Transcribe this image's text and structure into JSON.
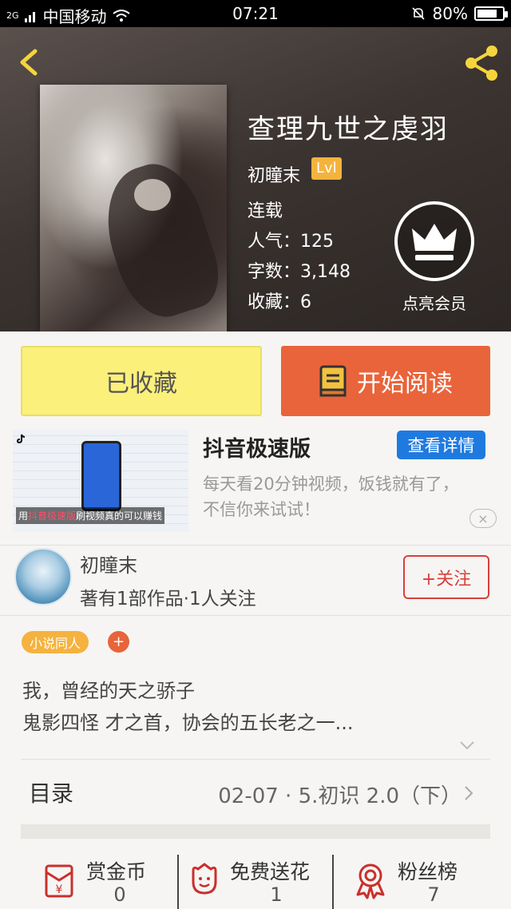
{
  "status_bar": {
    "network": "2G",
    "carrier": "中国移动",
    "time": "07:21",
    "battery": "80%",
    "battery_level": 0.8
  },
  "book": {
    "title": "查理九世之虔羽",
    "author": "初瞳末",
    "level": "Lvl",
    "status": "连载",
    "popularity": "人气：125",
    "word_count": "字数：3,148",
    "favorites": "收藏：6"
  },
  "vip": {
    "label": "点亮会员"
  },
  "actions": {
    "collect_label": "已收藏",
    "read_label": "开始阅读"
  },
  "ad": {
    "title": "抖音极速版",
    "detail_button": "查看详情",
    "description": "每天看20分钟视频，饭钱就有了，不信你来试试！",
    "caption_prefix": "用",
    "caption_highlight": "抖音极速版",
    "caption_suffix": "刷视频真的可以赚钱",
    "close_label": "×"
  },
  "author_row": {
    "name": "初瞳末",
    "meta": "著有1部作品·1人关注",
    "follow_button": "+关注"
  },
  "tags": {
    "tag1": "小说同人",
    "add_label": "+"
  },
  "synopsis": {
    "line1": "我，曾经的天之骄子",
    "line2": "鬼影四怪 才之首，协会的五长老之一..."
  },
  "catalog": {
    "label": "目录",
    "latest": "02-07 · 5.初识 2.0（下）"
  },
  "stats": [
    {
      "label": "赏金币",
      "value": "0"
    },
    {
      "label": "免费送花",
      "value": "1"
    },
    {
      "label": "粉丝榜",
      "value": "7"
    }
  ],
  "colors": {
    "accent_orange": "#e9643a",
    "collect_yellow": "#fbf07a",
    "follow_red": "#d9413a",
    "tag_yellow": "#f5b23e",
    "ad_blue": "#1f7ae0"
  }
}
